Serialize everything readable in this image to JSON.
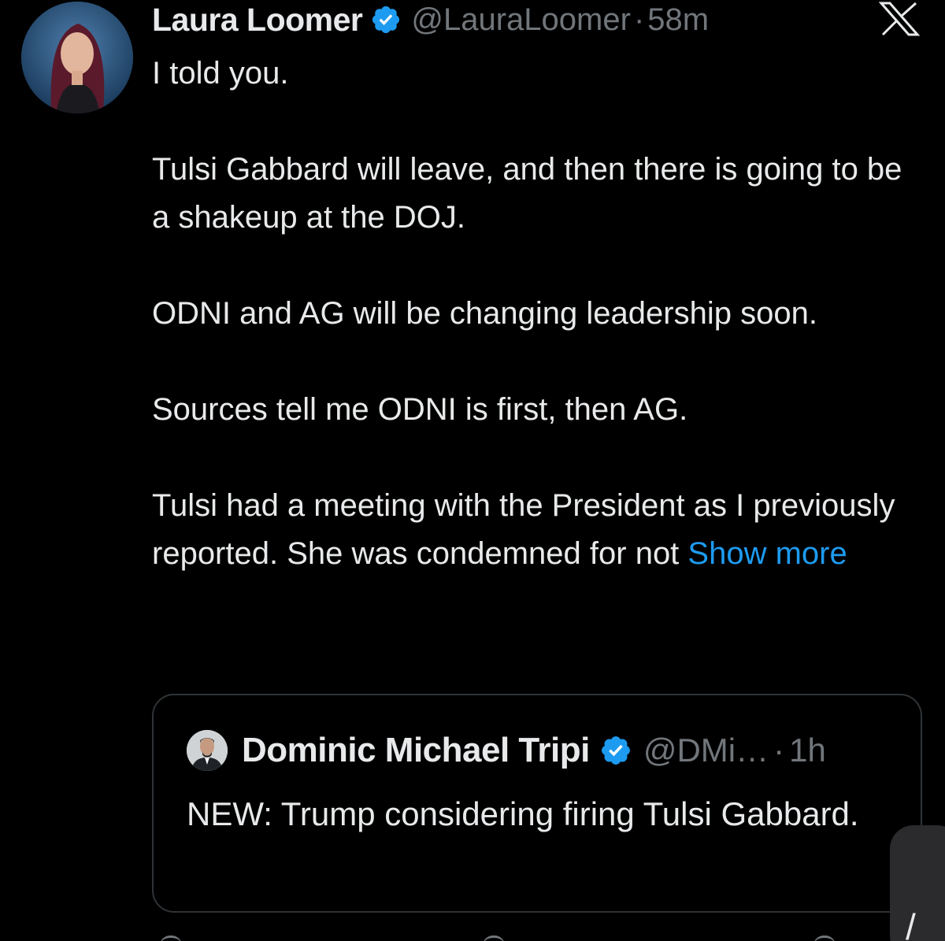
{
  "author": {
    "name": "Laura Loomer",
    "handle": "@LauraLoomer",
    "separator": "·",
    "time": "58m",
    "verified_color": "#1d9bf0"
  },
  "tweet": {
    "paragraphs": [
      "I told you.",
      "Tulsi Gabbard will leave, and then there is going to be a shakeup at the DOJ.",
      "ODNI and AG will be changing leadership soon.",
      "Sources tell me ODNI is first, then AG."
    ],
    "last_paragraph": "Tulsi had a meeting with the President as I previously reported. She was condemned for not",
    "show_more": "Show more"
  },
  "quote": {
    "name": "Dominic Michael Tripi",
    "handle": "@DMi…",
    "separator": "·",
    "time": "1h",
    "text": "NEW: Trump considering firing Tulsi Gabbard."
  },
  "icons": {
    "verified": "verified-badge-icon",
    "brand": "x-logo-icon",
    "side_widget": "compose-icon"
  },
  "side_widget_glyph": "/",
  "colors": {
    "background": "#000000",
    "text": "#e7e9ea",
    "secondary": "#71767b",
    "accent": "#1d9bf0",
    "border": "#2f3336"
  }
}
